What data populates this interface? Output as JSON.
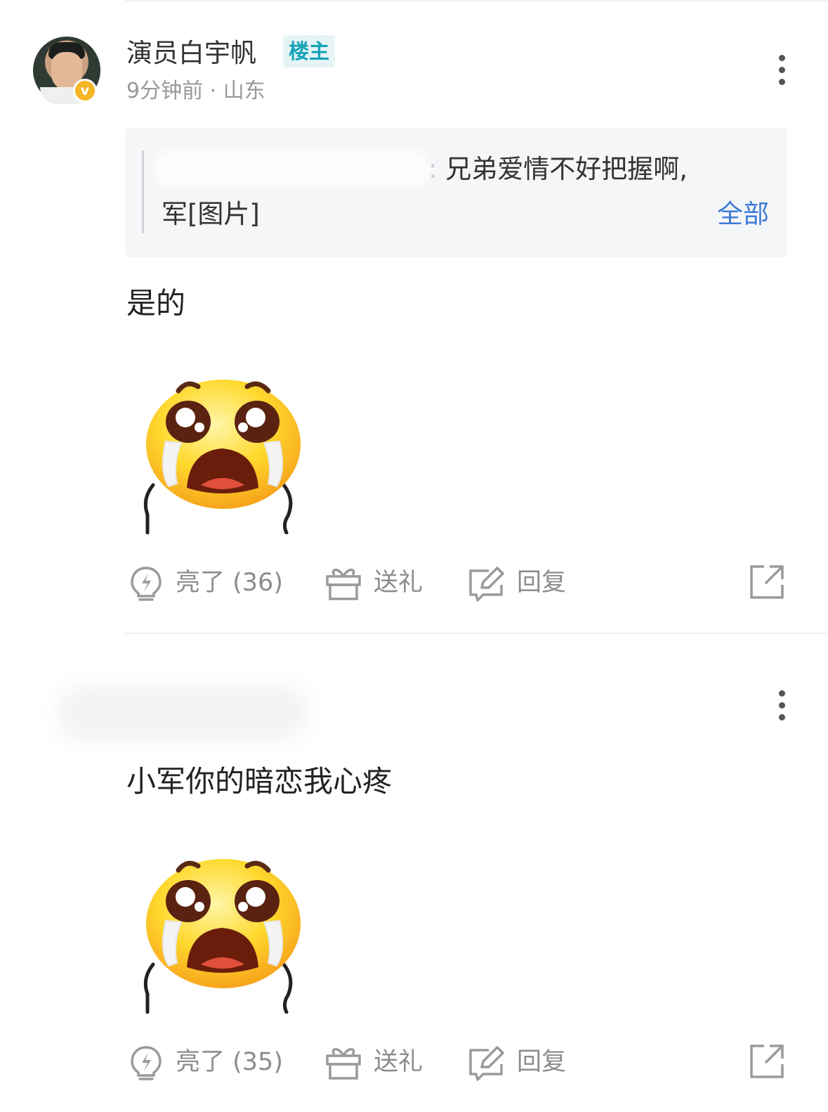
{
  "colors": {
    "accent_link": "#3d7bd6",
    "op_badge_text": "#16a3b8",
    "op_badge_bg": "#e6f4f6",
    "verified_badge": "#f4b625",
    "muted_text": "#8c8c8c"
  },
  "comments": [
    {
      "user": {
        "name": "演员白宇帆",
        "badge": "楼主",
        "verified_mark": "v",
        "avatar_icon": "avatar-photo-icon"
      },
      "meta": "9分钟前 · 山东",
      "quote": {
        "separator": ":",
        "line1": "兄弟爱情不好把握啊,",
        "line2": "军[图片]",
        "expand_label": "全部"
      },
      "text": "是的",
      "sticker": "crying-face-sticker",
      "actions": {
        "like_label": "亮了 (36)",
        "gift_label": "送礼",
        "reply_label": "回复",
        "share_icon": "share-icon"
      }
    },
    {
      "text": "小军你的暗恋我心疼",
      "sticker": "crying-face-sticker",
      "actions": {
        "like_label": "亮了 (35)",
        "gift_label": "送礼",
        "reply_label": "回复",
        "share_icon": "share-icon"
      }
    }
  ]
}
